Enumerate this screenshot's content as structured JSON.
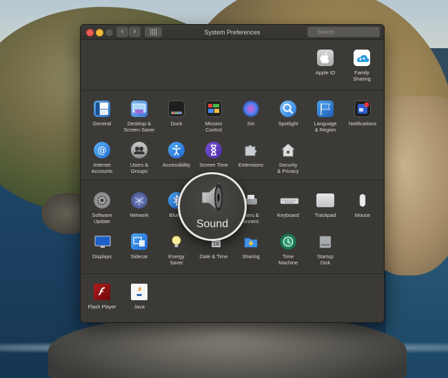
{
  "window": {
    "title": "System Preferences",
    "search_placeholder": "Search"
  },
  "nav": {
    "back_glyph": "‹",
    "forward_glyph": "›",
    "grid_glyph": "⣿⣿"
  },
  "account": [
    {
      "label": "Apple ID",
      "icon": "apple-icon"
    },
    {
      "label": "Family\nSharing",
      "icon": "family-sharing-icon"
    }
  ],
  "row1": [
    {
      "label": "General",
      "icon": "general-icon"
    },
    {
      "label": "Desktop &\nScreen Saver",
      "icon": "desktop-icon"
    },
    {
      "label": "Dock",
      "icon": "dock-icon"
    },
    {
      "label": "Mission\nControl",
      "icon": "mission-control-icon"
    },
    {
      "label": "Siri",
      "icon": "siri-icon"
    },
    {
      "label": "Spotlight",
      "icon": "spotlight-icon"
    },
    {
      "label": "Language\n& Region",
      "icon": "language-icon"
    },
    {
      "label": "Notifications",
      "icon": "notifications-icon"
    }
  ],
  "row2": [
    {
      "label": "Internet\nAccounts",
      "icon": "internet-accounts-icon"
    },
    {
      "label": "Users &\nGroups",
      "icon": "users-icon"
    },
    {
      "label": "Accessibility",
      "icon": "accessibility-icon"
    },
    {
      "label": "Screen Time",
      "icon": "screen-time-icon"
    },
    {
      "label": "Extensions",
      "icon": "extensions-icon"
    },
    {
      "label": "Security\n& Privacy",
      "icon": "security-icon"
    }
  ],
  "row3": [
    {
      "label": "Software\nUpdate",
      "icon": "software-update-icon"
    },
    {
      "label": "Network",
      "icon": "network-icon"
    },
    {
      "label": "Blueto",
      "icon": "bluetooth-icon"
    },
    {
      "label": "nters &\nanners",
      "icon": "printers-icon"
    },
    {
      "label": "Keyboard",
      "icon": "keyboard-icon"
    },
    {
      "label": "Trackpad",
      "icon": "trackpad-icon"
    },
    {
      "label": "Mouse",
      "icon": "mouse-icon"
    }
  ],
  "row4": [
    {
      "label": "Displays",
      "icon": "displays-icon"
    },
    {
      "label": "Sidecar",
      "icon": "sidecar-icon"
    },
    {
      "label": "Energy\nSaver",
      "icon": "energy-saver-icon"
    },
    {
      "label": "Date & Time",
      "icon": "date-time-icon"
    },
    {
      "label": "Sharing",
      "icon": "sharing-icon"
    },
    {
      "label": "Time\nMachine",
      "icon": "time-machine-icon"
    },
    {
      "label": "Startup\nDisk",
      "icon": "startup-disk-icon"
    }
  ],
  "third_party": [
    {
      "label": "Flash Player",
      "icon": "flash-player-icon"
    },
    {
      "label": "Java",
      "icon": "java-icon"
    }
  ],
  "magnifier": {
    "label": "Sound",
    "icon": "speaker-icon"
  }
}
